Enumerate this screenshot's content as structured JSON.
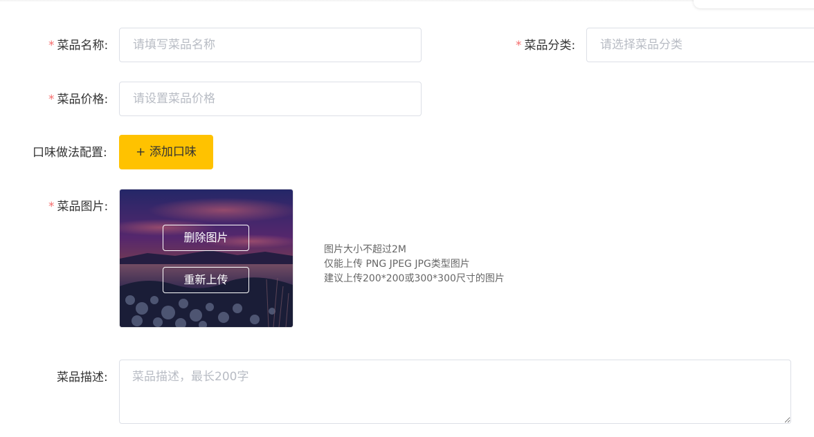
{
  "form": {
    "name": {
      "required_mark": "*",
      "label": "菜品名称:",
      "placeholder": "请填写菜品名称"
    },
    "category": {
      "required_mark": "*",
      "label": "菜品分类:",
      "placeholder": "请选择菜品分类"
    },
    "price": {
      "required_mark": "*",
      "label": "菜品价格:",
      "placeholder": "请设置菜品价格"
    },
    "flavor": {
      "label": "口味做法配置:",
      "add_button_label": "+ 添加口味"
    },
    "image": {
      "required_mark": "*",
      "label": "菜品图片:",
      "delete_button_label": "删除图片",
      "reupload_button_label": "重新上传",
      "tips": [
        "图片大小不超过2M",
        "仅能上传 PNG JPEG JPG类型图片",
        "建议上传200*200或300*300尺寸的图片"
      ]
    },
    "description": {
      "label": "菜品描述:",
      "placeholder": "菜品描述，最长200字"
    }
  },
  "colors": {
    "accent": "#ffc200",
    "required": "#f56c6c",
    "placeholder": "#b8bcc4",
    "border": "#dcdfe6"
  }
}
